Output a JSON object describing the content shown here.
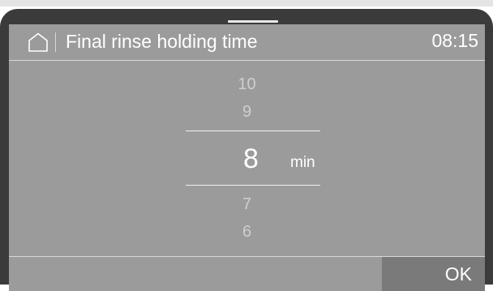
{
  "header": {
    "title": "Final rinse holding time",
    "time": "08:15",
    "home_icon": "home-icon"
  },
  "picker": {
    "options_above": [
      "10",
      "9"
    ],
    "selected_value": "8",
    "unit": "min",
    "options_below": [
      "7",
      "6"
    ]
  },
  "footer": {
    "ok_label": "OK"
  },
  "colors": {
    "screen_bg": "#9b9b9b",
    "bezel": "#3b3b3b",
    "ok_button_bg": "#7a7a7a",
    "text_primary": "#ffffff",
    "text_dimmed": "#cfcfcf"
  }
}
